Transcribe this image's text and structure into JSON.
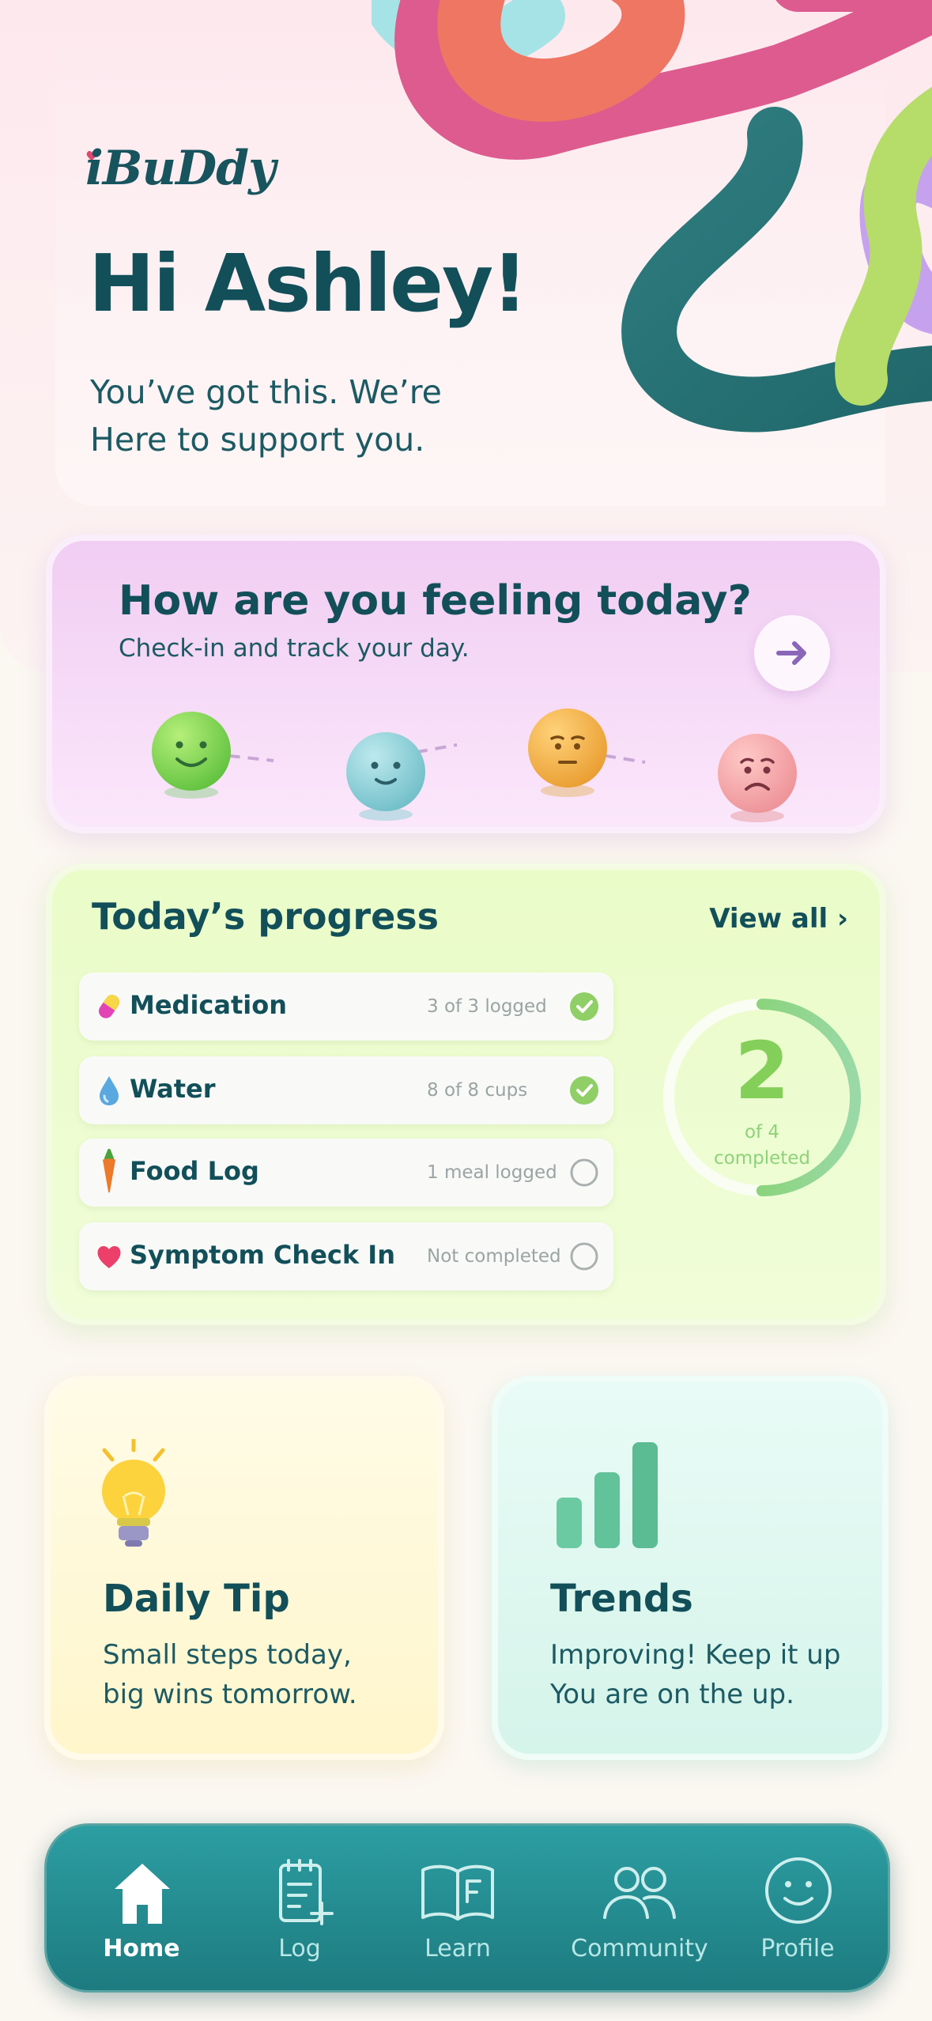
{
  "app": {
    "logo": "iBuDdy"
  },
  "hero": {
    "greeting": "Hi Ashley!",
    "subtitle_line1": "You’ve got this. We’re",
    "subtitle_line2": "Here to support you."
  },
  "feeling": {
    "title": "How are you feeling today?",
    "subtitle": "Check-in and track your day.",
    "moods": [
      "happy",
      "calm",
      "neutral",
      "sad"
    ]
  },
  "progress": {
    "title": "Today’s progress",
    "view_all": "View all ›",
    "completed_count": "2",
    "completed_caption_line1": "of 4",
    "completed_caption_line2": "completed",
    "completed_fraction": 0.5,
    "tasks": [
      {
        "label": "Medication",
        "status": "3 of 3 logged",
        "done": true,
        "icon": "pill-icon"
      },
      {
        "label": "Water",
        "status": "8 of 8 cups",
        "done": true,
        "icon": "water-drop-icon"
      },
      {
        "label": "Food Log",
        "status": "1 meal logged",
        "done": false,
        "icon": "carrot-icon"
      },
      {
        "label": "Symptom Check In",
        "status": "Not completed",
        "done": false,
        "icon": "heart-icon"
      }
    ]
  },
  "tip": {
    "title": "Daily Tip",
    "line1": "Small steps today,",
    "line2": "big wins tomorrow."
  },
  "trends": {
    "title": "Trends",
    "line1": "Improving! Keep it up",
    "line2": "You are on the up."
  },
  "nav": {
    "items": [
      {
        "label": "Home",
        "icon": "home-icon",
        "active": true
      },
      {
        "label": "Log",
        "icon": "log-icon",
        "active": false
      },
      {
        "label": "Learn",
        "icon": "book-icon",
        "active": false
      },
      {
        "label": "Community",
        "icon": "community-icon",
        "active": false
      },
      {
        "label": "Profile",
        "icon": "profile-icon",
        "active": false
      }
    ]
  },
  "colors": {
    "primary": "#124f59",
    "accent_green": "#83cf5a",
    "nav": "#1d7b80",
    "feeling_card": "#f1cdf3",
    "progress_card": "#eafcc8"
  }
}
